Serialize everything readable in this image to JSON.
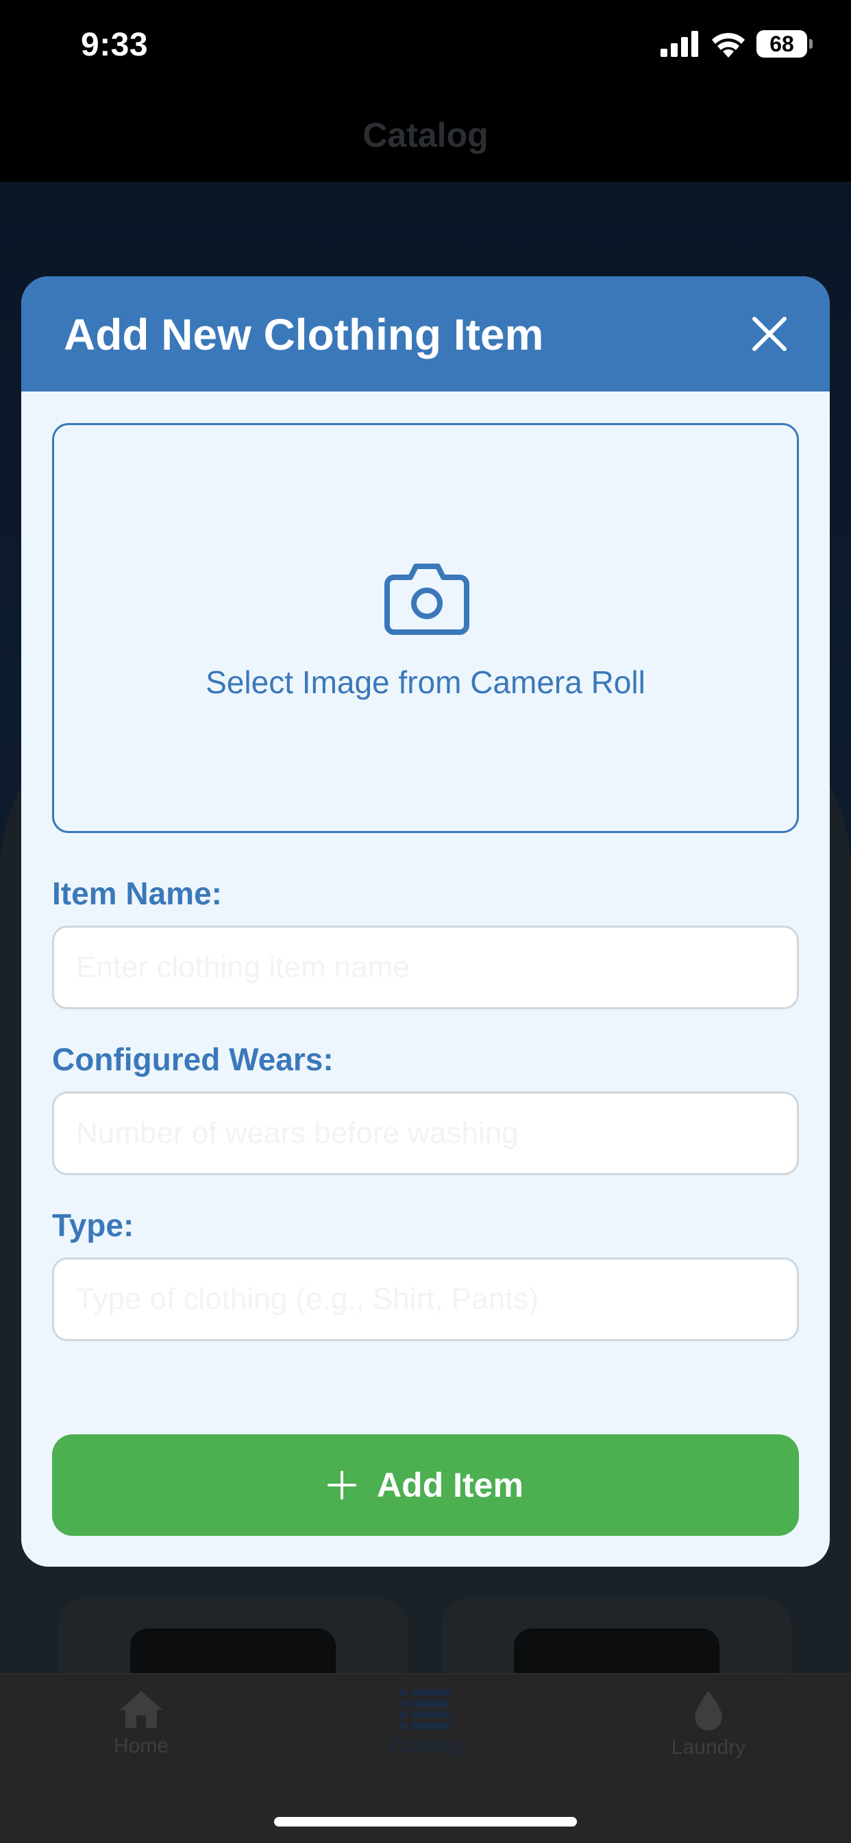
{
  "status_bar": {
    "time": "9:33",
    "battery": "68"
  },
  "nav": {
    "title": "Catalog"
  },
  "modal": {
    "title": "Add New Clothing Item",
    "image_picker_label": "Select Image from Camera Roll",
    "fields": [
      {
        "label": "Item Name:",
        "placeholder": "Enter clothing item name",
        "value": ""
      },
      {
        "label": "Configured Wears:",
        "placeholder": "Number of wears before washing",
        "value": ""
      },
      {
        "label": "Type:",
        "placeholder": "Type of clothing (e.g., Shirt, Pants)",
        "value": ""
      }
    ],
    "submit_label": "Add Item"
  },
  "tabs": [
    {
      "label": "Home",
      "icon": "home-icon",
      "active": false
    },
    {
      "label": "Catalog",
      "icon": "list-icon",
      "active": true
    },
    {
      "label": "Laundry",
      "icon": "water-drop-icon",
      "active": false
    }
  ],
  "colors": {
    "header_blue": "#3a78b9",
    "modal_bg": "#eef6fd",
    "button_green": "#4caf50"
  }
}
